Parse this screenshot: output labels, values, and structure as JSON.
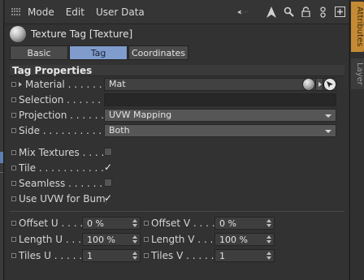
{
  "menubar": {
    "items": [
      "Mode",
      "Edit",
      "User Data"
    ],
    "icons": [
      "arrow-left-icon",
      "arrow-up-icon",
      "search-icon",
      "lock-icon",
      "link-icon",
      "add-icon"
    ]
  },
  "object": {
    "title": "Texture Tag [Texture]"
  },
  "tabs": [
    {
      "label": "Basic",
      "active": false
    },
    {
      "label": "Tag",
      "active": true
    },
    {
      "label": "Coordinates",
      "active": false
    }
  ],
  "section_title": "Tag Properties",
  "properties": {
    "material": {
      "label": "Material",
      "value": "Mat"
    },
    "selection": {
      "label": "Selection",
      "value": ""
    },
    "projection": {
      "label": "Projection",
      "value": "UVW Mapping"
    },
    "side": {
      "label": "Side",
      "value": "Both"
    },
    "mix_textures": {
      "label": "Mix Textures",
      "checked": false
    },
    "tile": {
      "label": "Tile",
      "checked": true
    },
    "seamless": {
      "label": "Seamless",
      "checked": false
    },
    "use_uvw": {
      "label": "Use UVW for Bump",
      "checked": true
    }
  },
  "numeric": {
    "offset_u": {
      "label": "Offset U",
      "value": "0 %"
    },
    "offset_v": {
      "label": "Offset V",
      "value": "0 %"
    },
    "length_u": {
      "label": "Length U",
      "value": "100 %"
    },
    "length_v": {
      "label": "Length V",
      "value": "100 %"
    },
    "tiles_u": {
      "label": "Tiles U",
      "value": "1"
    },
    "tiles_v": {
      "label": "Tiles V",
      "value": "1"
    }
  },
  "sidebar_tabs": [
    "Attributes",
    "Layer"
  ],
  "checkmark": "✓",
  "colors": {
    "active_tab": "#7f9ccc",
    "attributes_tab": "#c58a34"
  }
}
